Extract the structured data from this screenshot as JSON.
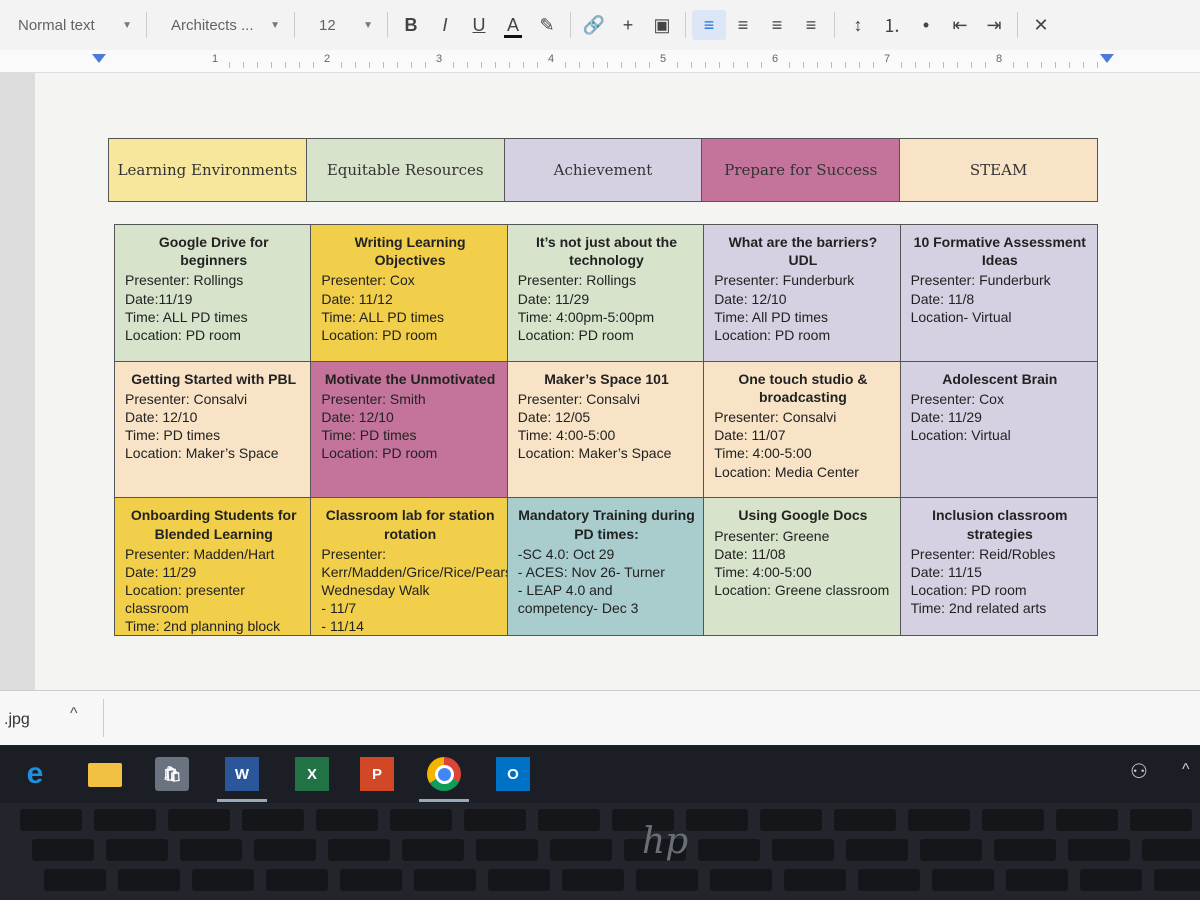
{
  "toolbar": {
    "style": "Normal text",
    "font": "Architects ...",
    "size": "12",
    "buttons": [
      {
        "name": "bold-button",
        "glyph": "B"
      },
      {
        "name": "italic-button",
        "glyph": "I"
      },
      {
        "name": "underline-button",
        "glyph": "U"
      },
      {
        "name": "text-color-button",
        "glyph": "A"
      },
      {
        "name": "highlight-button",
        "glyph": "✎"
      },
      {
        "name": "link-button",
        "glyph": "🔗"
      },
      {
        "name": "comment-button",
        "glyph": "+"
      },
      {
        "name": "image-button",
        "glyph": "▣"
      },
      {
        "name": "align-left-button",
        "glyph": "≡",
        "active": true
      },
      {
        "name": "align-center-button",
        "glyph": "≡"
      },
      {
        "name": "align-right-button",
        "glyph": "≡"
      },
      {
        "name": "justify-button",
        "glyph": "≡"
      },
      {
        "name": "line-spacing-button",
        "glyph": "↕"
      },
      {
        "name": "numbered-list-button",
        "glyph": "⒈"
      },
      {
        "name": "bulleted-list-button",
        "glyph": "•"
      },
      {
        "name": "decrease-indent-button",
        "glyph": "⇤"
      },
      {
        "name": "increase-indent-button",
        "glyph": "⇥"
      },
      {
        "name": "clear-formatting-button",
        "glyph": "✕"
      }
    ]
  },
  "ruler": {
    "numbers": [
      "1",
      "2",
      "3",
      "4",
      "5",
      "6",
      "7",
      "8"
    ]
  },
  "header_row": [
    {
      "label": "Learning Environments",
      "color": "#f6e79c"
    },
    {
      "label": "Equitable Resources",
      "color": "#d8e3cb"
    },
    {
      "label": "Achievement",
      "color": "#d6d1e2"
    },
    {
      "label": "Prepare for Success",
      "color": "#c4749a"
    },
    {
      "label": "STEAM",
      "color": "#f8e3c6"
    }
  ],
  "sessions": [
    {
      "title": "Google Drive for beginners",
      "lines": [
        "Presenter: Rollings",
        "Date:11/19",
        "Time: ALL PD times",
        "Location: PD room"
      ],
      "color": "#d8e3cb"
    },
    {
      "title": "Writing Learning Objectives",
      "lines": [
        "Presenter: Cox",
        "Date: 11/12",
        "Time: ALL PD times",
        "Location: PD room"
      ],
      "color": "#f1cf4a"
    },
    {
      "title": "It’s not just about the technology",
      "lines": [
        "Presenter: Rollings",
        "Date: 11/29",
        "Time: 4:00pm-5:00pm",
        "Location: PD room"
      ],
      "color": "#d8e3cb"
    },
    {
      "title": "What are the barriers? UDL",
      "lines": [
        "Presenter: Funderburk",
        "Date: 12/10",
        "Time: All PD times",
        "Location: PD room"
      ],
      "color": "#d6d1e2"
    },
    {
      "title": "10 Formative Assessment Ideas",
      "lines": [
        "Presenter: Funderburk",
        "Date: 11/8",
        "Location- Virtual"
      ],
      "color": "#d6d1e2"
    },
    {
      "title": "Getting Started with PBL",
      "lines": [
        "Presenter: Consalvi",
        "Date: 12/10",
        "Time: PD times",
        "Location: Maker’s Space"
      ],
      "color": "#f8e3c6"
    },
    {
      "title": "Motivate the Unmotivated",
      "lines": [
        "Presenter: Smith",
        "Date: 12/10",
        "Time: PD times",
        "Location: PD room"
      ],
      "color": "#c4749a"
    },
    {
      "title": "Maker’s Space 101",
      "lines": [
        "Presenter: Consalvi",
        "Date: 12/05",
        "Time: 4:00-5:00",
        "Location: Maker’s Space"
      ],
      "color": "#f8e3c6"
    },
    {
      "title": "One touch studio & broadcasting",
      "lines": [
        "Presenter: Consalvi",
        "Date: 11/07",
        "Time: 4:00-5:00",
        "Location: Media Center"
      ],
      "color": "#f8e3c6"
    },
    {
      "title": "Adolescent Brain",
      "lines": [
        "Presenter: Cox",
        "Date: 11/29",
        "Location: Virtual"
      ],
      "color": "#d6d1e2"
    },
    {
      "title": "Onboarding Students for Blended Learning",
      "lines": [
        "Presenter: Madden/Hart",
        "Date: 11/29",
        "Location: presenter classroom",
        "Time: 2nd planning block"
      ],
      "color": "#f1cf4a"
    },
    {
      "title": "Classroom lab for station rotation",
      "lines": [
        "Presenter: Kerr/Madden/Grice/Rice/Pearson/Rhodes/Denio",
        "Wednesday Walk",
        "- 11/7",
        "- 11/14"
      ],
      "color": "#f1cf4a"
    },
    {
      "title": "Mandatory Training during PD times:",
      "lines": [
        "-SC 4.0: Oct 29",
        "- ACES: Nov 26- Turner",
        "- LEAP 4.0 and competency- Dec 3"
      ],
      "color": "#a9cccc"
    },
    {
      "title": "Using Google Docs",
      "lines": [
        "Presenter: Greene",
        "Date: 11/08",
        "Time: 4:00-5:00",
        "Location: Greene classroom"
      ],
      "color": "#d8e3cb"
    },
    {
      "title": "Inclusion classroom strategies",
      "lines": [
        "Presenter: Reid/Robles",
        "Date: 11/15",
        "Location: PD room",
        "Time: 2nd related arts"
      ],
      "color": "#d6d1e2"
    }
  ],
  "download_bar": {
    "file": ".jpg",
    "caret": "^"
  },
  "taskbar": {
    "apps": [
      {
        "name": "edge-icon",
        "glyph": "e"
      },
      {
        "name": "file-explorer-icon",
        "glyph": ""
      },
      {
        "name": "store-icon",
        "glyph": "🛍"
      },
      {
        "name": "word-icon",
        "glyph": "W"
      },
      {
        "name": "excel-icon",
        "glyph": "X"
      },
      {
        "name": "powerpoint-icon",
        "glyph": "P"
      },
      {
        "name": "chrome-icon",
        "glyph": ""
      },
      {
        "name": "outlook-icon",
        "glyph": "O"
      }
    ]
  },
  "laptop": {
    "brand": "hp"
  }
}
